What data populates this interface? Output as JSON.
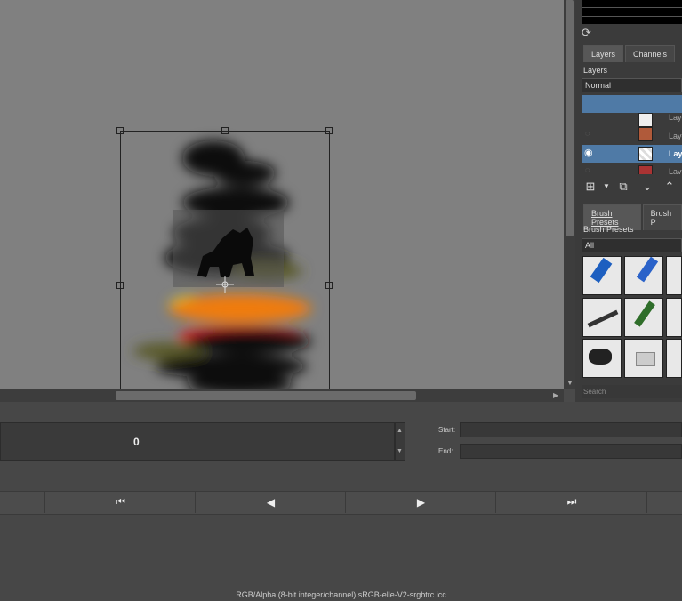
{
  "docker": {
    "tabs": [
      "Layers",
      "Channels"
    ],
    "layers_label": "Layers",
    "blend_mode": "Normal",
    "layer_names": [
      "Laye",
      "Laye",
      "Laye",
      "Laye"
    ],
    "brush_tabs": [
      "Brush Presets",
      "Brush P"
    ],
    "brush_presets_label": "Brush Presets",
    "brush_filter": "All",
    "search_placeholder": "Search"
  },
  "timeline": {
    "frame_value": "0",
    "start_label": "Start:",
    "end_label": "End:"
  },
  "status": {
    "color_profile": "RGB/Alpha (8-bit integer/channel)  sRGB-elle-V2-srgbtrc.icc"
  },
  "icons": [
    "refresh-icon",
    "eye-icon",
    "add-layer-icon",
    "duplicate-icon",
    "move-down-icon",
    "move-up-icon",
    "first-frame-icon",
    "prev-frame-icon",
    "play-icon",
    "next-frame-icon"
  ]
}
